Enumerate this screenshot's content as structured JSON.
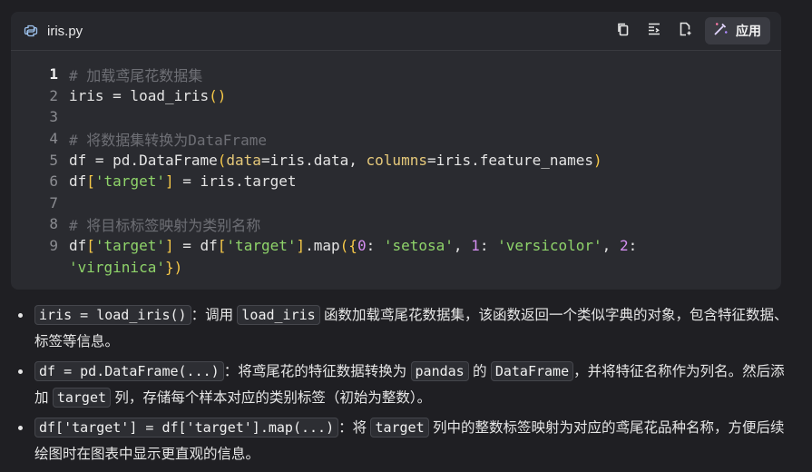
{
  "header": {
    "filename": "iris.py",
    "apply_label": "应用",
    "icons": [
      "python-file-icon",
      "copy-icon",
      "insert-icon",
      "new-file-icon",
      "apply-wand-icon"
    ]
  },
  "code": {
    "line_numbers": [
      "1",
      "2",
      "3",
      "4",
      "5",
      "6",
      "7",
      "8",
      "9"
    ],
    "lines": [
      "# 加载鸢尾花数据集",
      "iris = load_iris()",
      "",
      "# 将数据集转换为DataFrame",
      "df = pd.DataFrame(data=iris.data, columns=iris.feature_names)",
      "df['target'] = iris.target",
      "",
      "# 将目标标签映射为类别名称",
      "df['target'] = df['target'].map({0: 'setosa', 1: 'versicolor', 2:",
      "'virginica'})"
    ]
  },
  "bullets": [
    {
      "code1": "iris = load_iris()",
      "text1": "：调用",
      "code2": "load_iris",
      "text2": "函数加载鸢尾花数据集，该函数返回一个类似字典的对象，包含特征数据、标签等信息。"
    },
    {
      "code1": "df = pd.DataFrame(...)",
      "text1": "：将鸢尾花的特征数据转换为",
      "code2": "pandas",
      "text2": "的",
      "code3": "DataFrame",
      "text3": "，并将特征名称作为列名。然后添加",
      "code4": "target",
      "text4": "列，存储每个样本对应的类别标签（初始为整数）。"
    },
    {
      "code1": "df['target'] = df['target'].map(...)",
      "text1": "：将",
      "code2": "target",
      "text2": "列中的整数标签映射为对应的鸢尾花品种名称，方便后续绘图时在图表中显示更直观的信息。"
    }
  ],
  "colors": {
    "background": "#1f1f23",
    "card": "#2a2b30",
    "comment": "#6e6f75",
    "string": "#8fd46a",
    "number": "#d48ef0",
    "bracket": "#f7c948",
    "param": "#e6c97a"
  }
}
